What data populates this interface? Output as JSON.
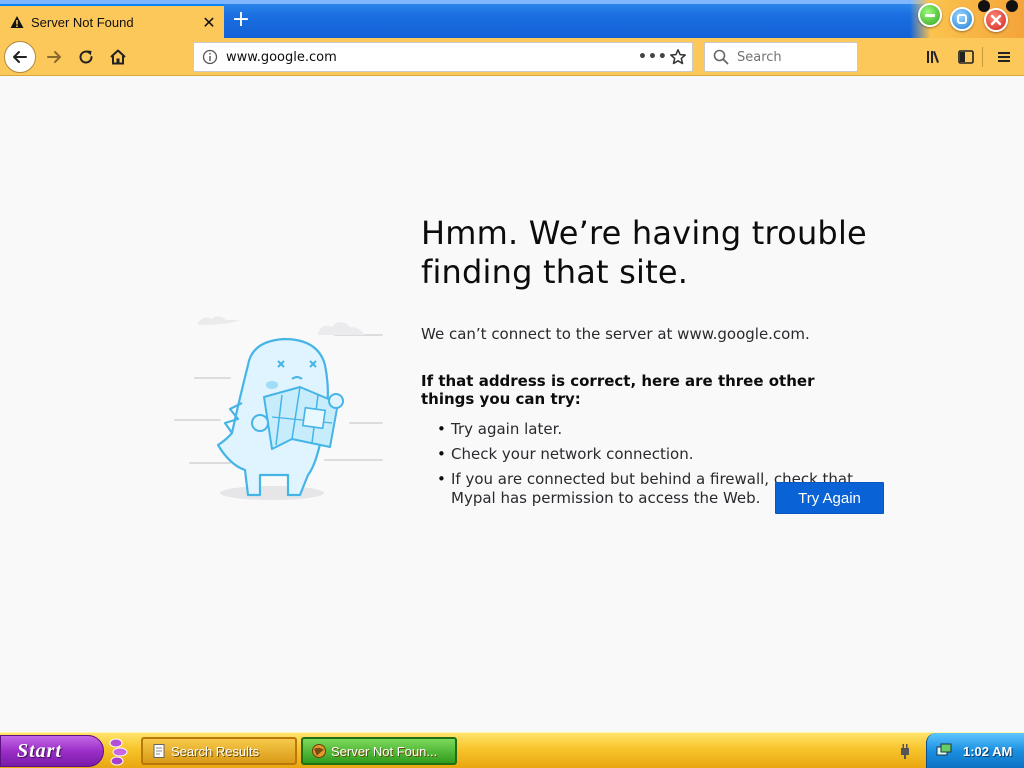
{
  "window": {
    "tab_title": "Server Not Found",
    "new_tab_label": "+"
  },
  "navbar": {
    "url": "www.google.com",
    "search_placeholder": "Search",
    "page_actions_label": "•••"
  },
  "page": {
    "title": "Hmm. We’re having trouble finding that site.",
    "description": "We can’t connect to the server at www.google.com.",
    "tips_heading": "If that address is correct, here are three other things you can try:",
    "tips": [
      "Try again later.",
      "Check your network connection.",
      "If you are connected but behind a firewall, check that Mypal has permission to access the Web."
    ],
    "try_again_label": "Try Again"
  },
  "taskbar": {
    "start_label": "Start",
    "tasks": [
      {
        "label": "Search Results"
      },
      {
        "label": "Server Not Foun..."
      }
    ],
    "clock": "1:02 AM"
  },
  "colors": {
    "toolbar": "#fdc85a",
    "accent_button": "#0a63d6",
    "tab_strip": "#1b6fe0",
    "taskbar": "#f8c42b",
    "start_button": "#9b2fc8"
  },
  "icons": {
    "tab": "warning-icon",
    "back": "back-arrow-icon",
    "forward": "forward-arrow-icon",
    "reload": "reload-icon",
    "home": "home-icon",
    "site_info": "info-icon",
    "bookmark": "star-icon",
    "search": "search-icon",
    "library": "library-icon",
    "sidebar": "sidebar-icon",
    "menu": "hamburger-menu-icon"
  }
}
